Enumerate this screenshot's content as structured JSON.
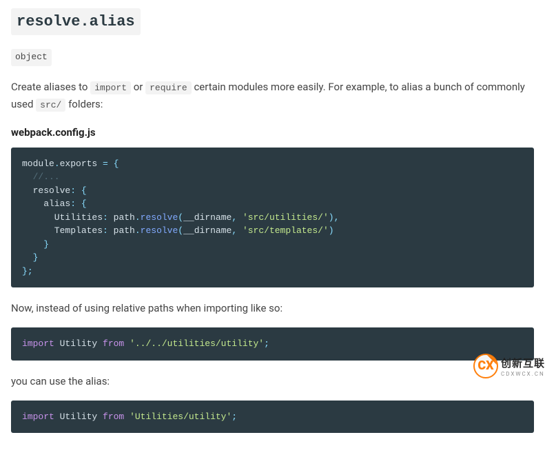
{
  "heading": "resolve.alias",
  "typeBadge": "object",
  "intro": {
    "part1": "Create aliases to ",
    "code1": "import",
    "part2": " or ",
    "code2": "require",
    "part3": " certain modules more easily. For example, to alias a bunch of commonly used ",
    "code3": "src/",
    "part4": " folders:"
  },
  "filename": "webpack.config.js",
  "code1": {
    "l1a": "module",
    "l1b": ".",
    "l1c": "exports ",
    "l1d": "=",
    "l1e": " {",
    "l2": "  //...",
    "l3a": "  resolve",
    "l3b": ":",
    "l3c": " {",
    "l4a": "    alias",
    "l4b": ":",
    "l4c": " {",
    "l5a": "      Utilities",
    "l5b": ":",
    "l5c": " path",
    "l5d": ".",
    "l5e": "resolve",
    "l5f": "(",
    "l5g": "__dirname",
    "l5h": ",",
    "l5i": " ",
    "l5j": "'src/utilities/'",
    "l5k": ")",
    "l5l": ",",
    "l6a": "      Templates",
    "l6b": ":",
    "l6c": " path",
    "l6d": ".",
    "l6e": "resolve",
    "l6f": "(",
    "l6g": "__dirname",
    "l6h": ",",
    "l6i": " ",
    "l6j": "'src/templates/'",
    "l6k": ")",
    "l7": "    }",
    "l8": "  }",
    "l9a": "}",
    "l9b": ";"
  },
  "mid1": "Now, instead of using relative paths when importing like so:",
  "code2": {
    "a": "import",
    "b": " Utility ",
    "c": "from",
    "d": " ",
    "e": "'../../utilities/utility'",
    "f": ";"
  },
  "mid2": "you can use the alias:",
  "code3": {
    "a": "import",
    "b": " Utility ",
    "c": "from",
    "d": " ",
    "e": "'Utilities/utility'",
    "f": ";"
  },
  "watermark": {
    "logo": "CX",
    "text": "创新互联",
    "sub": "CDXWCX.CN"
  }
}
